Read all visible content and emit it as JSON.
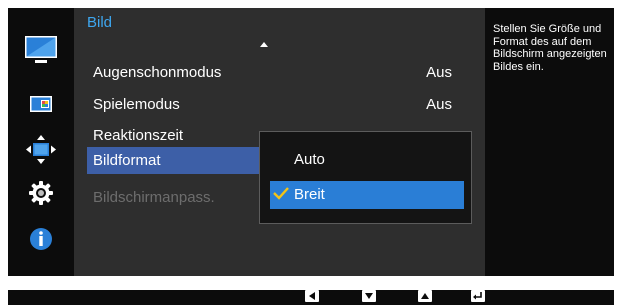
{
  "menu": {
    "title": "Bild",
    "items": [
      {
        "label": "Augenschonmodus",
        "value": "Aus"
      },
      {
        "label": "Spielemodus",
        "value": "Aus"
      },
      {
        "label": "Reaktionszeit",
        "value": ""
      },
      {
        "label": "Bildformat",
        "value": ""
      },
      {
        "label": "Bildschirmanpass.",
        "value": ""
      }
    ]
  },
  "submenu": {
    "options": [
      {
        "label": "Auto"
      },
      {
        "label": "Breit"
      }
    ],
    "selected": "Breit"
  },
  "help": {
    "text": "Stellen Sie Größe und Format des auf dem Bildschirm angezeigten Bildes ein."
  },
  "sidebar": {
    "icons": [
      "monitor-picture-icon",
      "color-icon",
      "size-position-icon",
      "settings-gear-icon",
      "information-icon"
    ]
  },
  "bottom_keys": [
    "left-arrow-key-icon",
    "down-arrow-key-icon",
    "up-arrow-key-icon",
    "enter-key-icon"
  ],
  "colors": {
    "title_accent": "#3ea7f0",
    "selected_item": "#3d5fa7",
    "selected_option": "#2a7ed6",
    "checkmark": "#f3c417",
    "disabled_text": "#6d6d6d"
  }
}
